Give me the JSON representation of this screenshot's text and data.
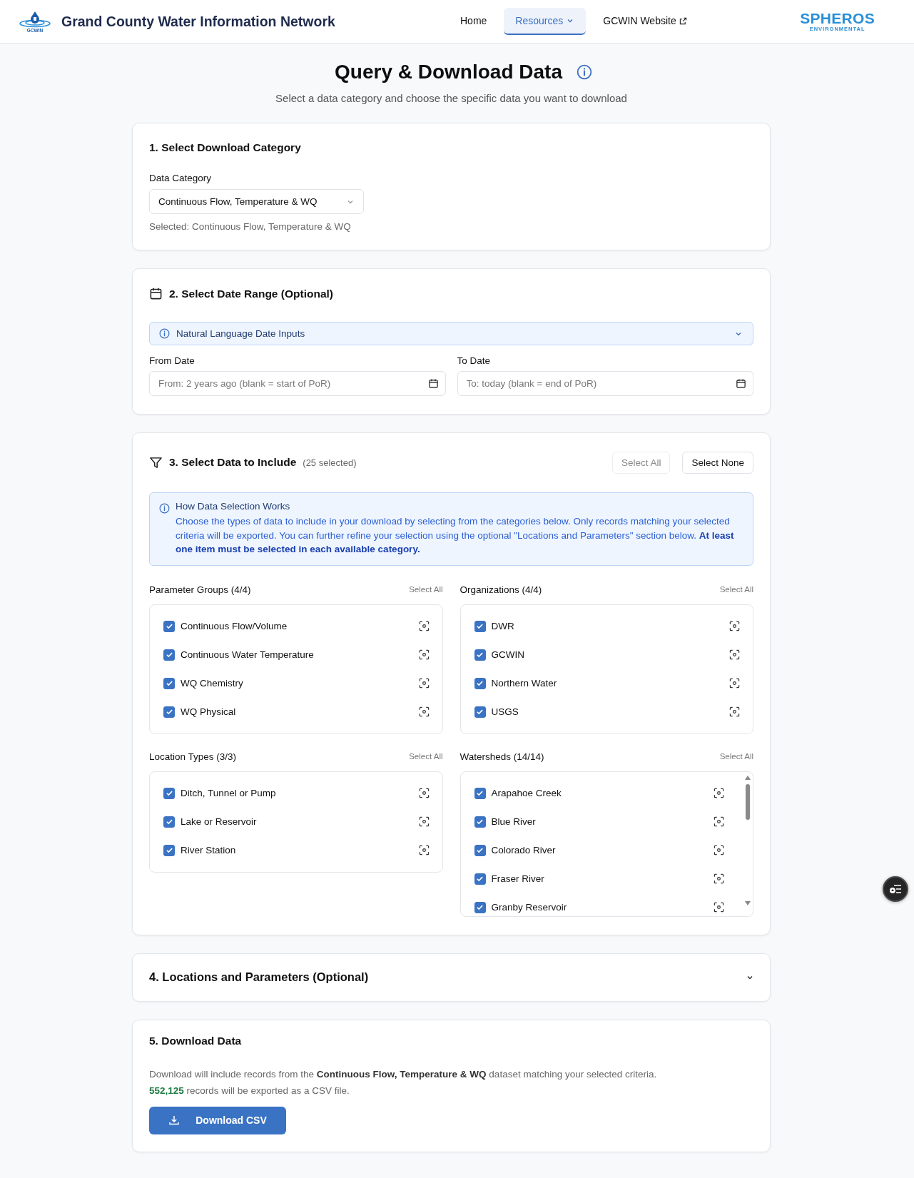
{
  "header": {
    "logo_text": "GCWIN",
    "title": "Grand County Water Information Network",
    "nav": [
      {
        "label": "Home",
        "kind": "link",
        "selected": false
      },
      {
        "label": "Resources",
        "kind": "menu",
        "selected": true
      },
      {
        "label": "GCWIN Website",
        "kind": "external",
        "selected": false
      }
    ],
    "partner_logo": {
      "name": "SPHEROS",
      "tagline": "ENVIRONMENTAL"
    }
  },
  "page": {
    "title": "Query & Download Data",
    "subtitle": "Select a data category and choose the specific data you want to download"
  },
  "category_section": {
    "title": "1. Select Download Category",
    "field_label": "Data Category",
    "value": "Continuous Flow, Temperature & WQ",
    "selected_note": "Selected: Continuous Flow, Temperature & WQ"
  },
  "date_section": {
    "title": "2. Select Date Range (Optional)",
    "notice": {
      "label": "Natural Language Date Inputs",
      "expanded": false
    },
    "fields": [
      {
        "label": "From Date",
        "placeholder": "From: 2 years ago (blank = start of PoR)"
      },
      {
        "label": "To Date",
        "placeholder": "To: today (blank = end of PoR)"
      }
    ]
  },
  "data_section": {
    "title": "3. Select Data to Include",
    "count": "(25 selected)",
    "buttons": [
      {
        "label": "Select All",
        "disabled": true
      },
      {
        "label": "Select None",
        "disabled": false
      }
    ],
    "info": {
      "title": "How Data Selection Works",
      "text": "Choose the types of data to include in your download by selecting from the categories below. Only records matching your selected criteria will be exported. You can further refine your selection using the optional \"Locations and Parameters\" section below. **At least one item must be selected in each available category.**"
    },
    "groups": [
      {
        "title": "Parameter Groups (4/4)",
        "action": "Select All",
        "scrollable": false,
        "items": [
          {
            "label": "Continuous Flow/Volume",
            "checked": true
          },
          {
            "label": "Continuous Water Temperature",
            "checked": true
          },
          {
            "label": "WQ Chemistry",
            "checked": true
          },
          {
            "label": "WQ Physical",
            "checked": true
          }
        ]
      },
      {
        "title": "Organizations (4/4)",
        "action": "Select All",
        "scrollable": false,
        "items": [
          {
            "label": "DWR",
            "checked": true
          },
          {
            "label": "GCWIN",
            "checked": true
          },
          {
            "label": "Northern Water",
            "checked": true
          },
          {
            "label": "USGS",
            "checked": true
          }
        ]
      },
      {
        "title": "Location Types (3/3)",
        "action": "Select All",
        "scrollable": false,
        "items": [
          {
            "label": "Ditch, Tunnel or Pump",
            "checked": true
          },
          {
            "label": "Lake or Reservoir",
            "checked": true
          },
          {
            "label": "River Station",
            "checked": true
          }
        ]
      },
      {
        "title": "Watersheds (14/14)",
        "action": "Select All",
        "scrollable": true,
        "items": [
          {
            "label": "Arapahoe Creek",
            "checked": true
          },
          {
            "label": "Blue River",
            "checked": true
          },
          {
            "label": "Colorado River",
            "checked": true
          },
          {
            "label": "Fraser River",
            "checked": true
          },
          {
            "label": "Granby Reservoir",
            "checked": true
          }
        ]
      }
    ]
  },
  "locations_section": {
    "title": "4. Locations and Parameters (Optional)",
    "expanded": false
  },
  "download_section": {
    "title": "5. Download Data",
    "description": "Download will include records from the **Continuous Flow, Temperature & WQ** dataset matching your selected criteria.",
    "count_line": "**552,125** records will be exported as a CSV file.",
    "button": "Download CSV"
  }
}
